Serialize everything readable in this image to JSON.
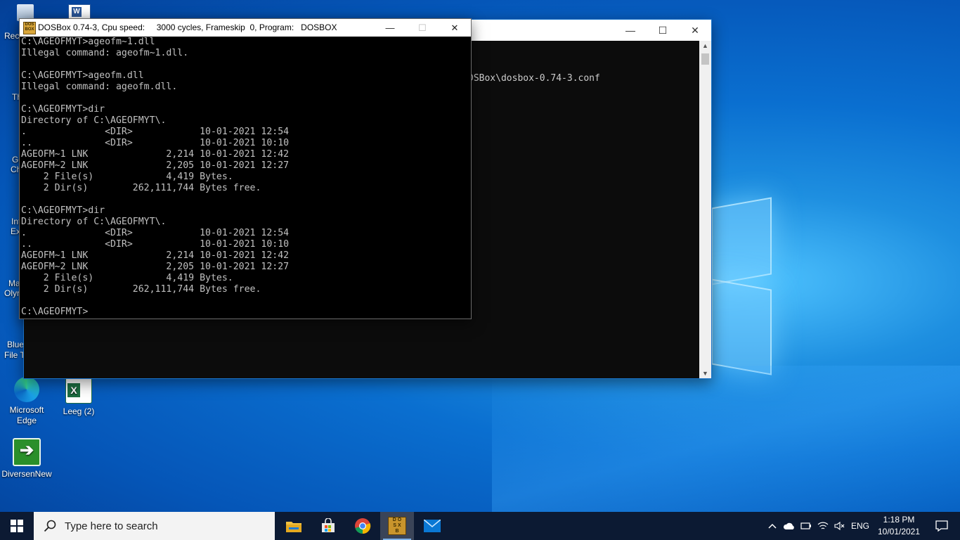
{
  "desktop": {
    "icons": [
      {
        "label": "Microsoft\nEdge",
        "name": "edge"
      },
      {
        "label": "Leeg (2)",
        "name": "excel-leeg"
      },
      {
        "label": "DiversenNew",
        "name": "diversen-new"
      }
    ],
    "partial_labels": [
      "Rec",
      "Th",
      "Go",
      "Ch",
      "Int",
      "Ex",
      "Ma",
      "Olyr",
      "Blue",
      "File Tr"
    ]
  },
  "console_window": {
    "text": "DSBox\\dosbox-0.74-3.conf",
    "controls": {
      "minimize": "—",
      "maximize": "☐",
      "close": "✕"
    }
  },
  "dosbox": {
    "title": "DOSBox 0.74-3, Cpu speed:     3000 cycles, Frameskip  0, Program:   DOSBOX",
    "controls": {
      "minimize": "—",
      "maximize": "☐",
      "close": "✕"
    },
    "lines": [
      "C:\\AGEOFMYT>ageofm~1.dll",
      "Illegal command: ageofm~1.dll.",
      "",
      "C:\\AGEOFMYT>ageofm.dll",
      "Illegal command: ageofm.dll.",
      "",
      "C:\\AGEOFMYT>dir",
      "Directory of C:\\AGEOFMYT\\.",
      ".              <DIR>            10-01-2021 12:54",
      "..             <DIR>            10-01-2021 10:10",
      "AGEOFM~1 LNK              2,214 10-01-2021 12:42",
      "AGEOFM~2 LNK              2,205 10-01-2021 12:27",
      "    2 File(s)             4,419 Bytes.",
      "    2 Dir(s)        262,111,744 Bytes free.",
      "",
      "C:\\AGEOFMYT>dir",
      "Directory of C:\\AGEOFMYT\\.",
      ".              <DIR>            10-01-2021 12:54",
      "..             <DIR>            10-01-2021 10:10",
      "AGEOFM~1 LNK              2,214 10-01-2021 12:42",
      "AGEOFM~2 LNK              2,205 10-01-2021 12:27",
      "    2 File(s)             4,419 Bytes.",
      "    2 Dir(s)        262,111,744 Bytes free.",
      "",
      "C:\\AGEOFMYT>"
    ]
  },
  "taskbar": {
    "search_placeholder": "Type here to search",
    "apps": [
      "file-explorer",
      "microsoft-store",
      "chrome",
      "dosbox",
      "mail"
    ],
    "tray": {
      "language": "ENG",
      "time": "1:18 PM",
      "date": "10/01/2021"
    }
  },
  "colors": {
    "taskbar": "#0c1a33",
    "desktop": "#0a6fd0",
    "dos_text": "#c0c0c0"
  }
}
